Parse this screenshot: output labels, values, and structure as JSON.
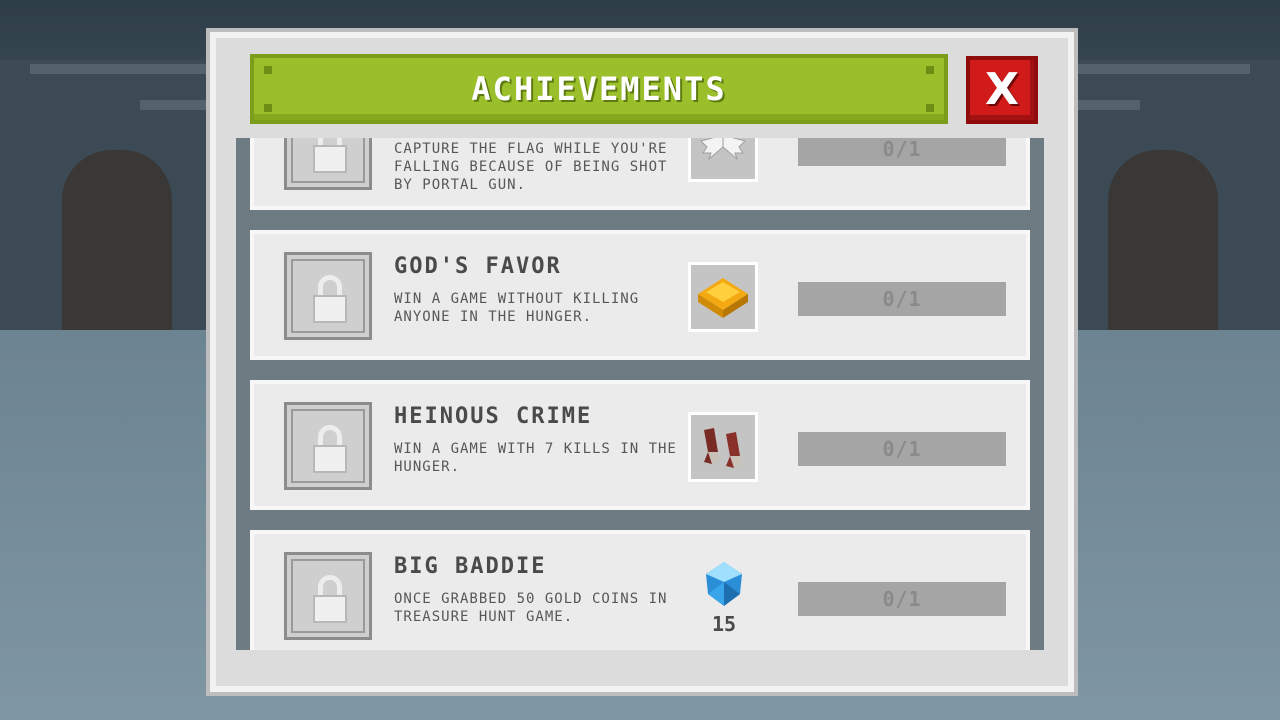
{
  "title": "ACHIEVEMENTS",
  "close_label": "X",
  "achievements": [
    {
      "name": "",
      "description": "CAPTURE THE FLAG WHILE YOU'RE FALLING BECAUSE OF BEING SHOT BY PORTAL GUN.",
      "reward_icon": "wings-icon",
      "progress": "0/1"
    },
    {
      "name": "GOD'S FAVOR",
      "description": "WIN A GAME WITHOUT KILLING ANYONE IN THE HUNGER.",
      "reward_icon": "gold-plate-icon",
      "progress": "0/1"
    },
    {
      "name": "HEINOUS CRIME",
      "description": "WIN A GAME WITH 7 KILLS IN THE HUNGER.",
      "reward_icon": "boots-icon",
      "progress": "0/1"
    },
    {
      "name": "BIG BADDIE",
      "description": "ONCE GRABBED 50 GOLD COINS IN TREASURE HUNT GAME.",
      "reward_icon": "gem-icon",
      "reward_amount": "15",
      "progress": "0/1"
    }
  ],
  "colors": {
    "title_green": "#9bbf2a",
    "close_red": "#d11a1a",
    "card_bg": "#ebebeb",
    "progress_bg": "#a5a5a5"
  }
}
